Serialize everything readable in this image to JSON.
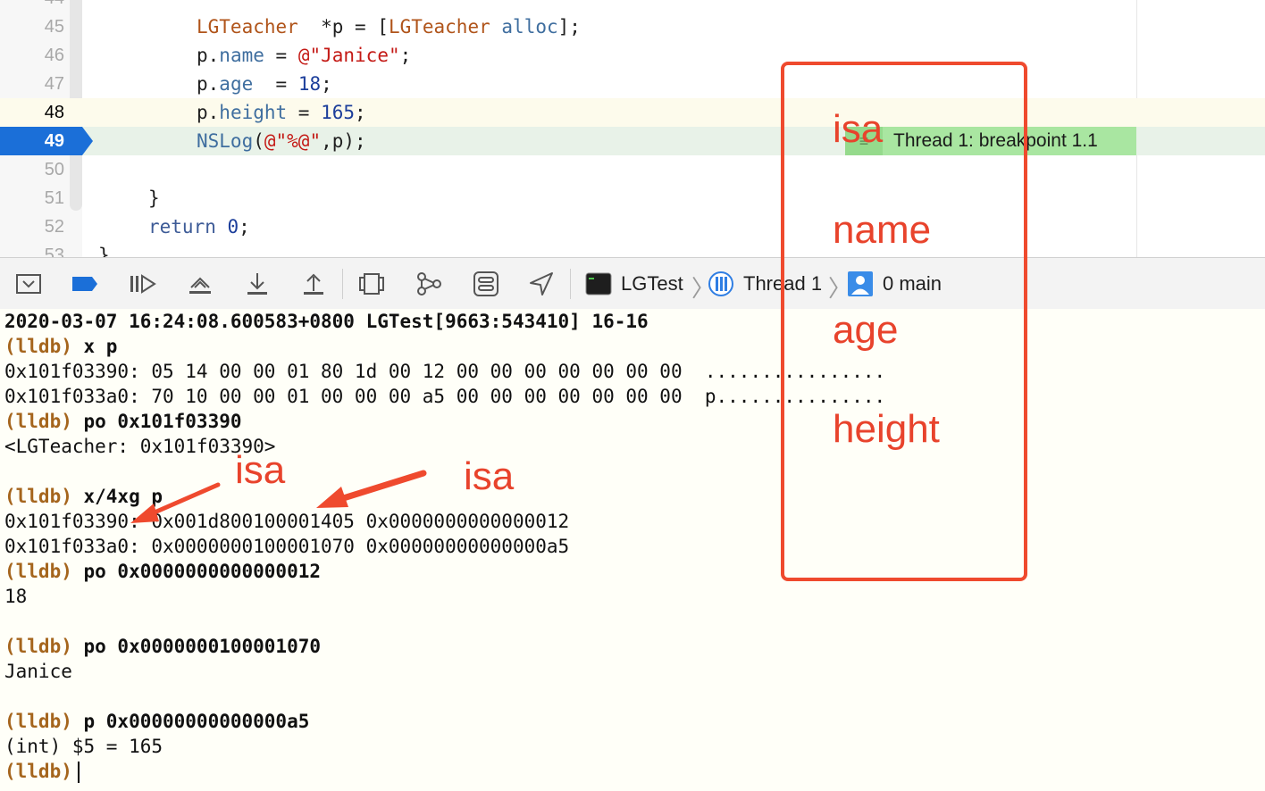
{
  "editor": {
    "lines": [
      {
        "num": "44",
        "state": "normal"
      },
      {
        "num": "45",
        "state": "normal"
      },
      {
        "num": "46",
        "state": "normal"
      },
      {
        "num": "47",
        "state": "normal"
      },
      {
        "num": "48",
        "state": "current"
      },
      {
        "num": "49",
        "state": "exec"
      },
      {
        "num": "50",
        "state": "normal"
      },
      {
        "num": "51",
        "state": "normal"
      },
      {
        "num": "52",
        "state": "normal"
      },
      {
        "num": "53",
        "state": "normal"
      }
    ],
    "code": {
      "l45": {
        "cls": "LGTeacher",
        "mid": "  *p = [",
        "cls2": "LGTeacher",
        "msg": "alloc",
        "end": "];"
      },
      "l46": {
        "obj": "p.",
        "prop": "name",
        "mid": " = ",
        "str": "@\"Janice\"",
        "end": ";"
      },
      "l47": {
        "obj": "p.",
        "prop": "age",
        "mid": "  = ",
        "num": "18",
        "end": ";"
      },
      "l48": {
        "obj": "p.",
        "prop": "height",
        "mid": " = ",
        "num": "165",
        "end": ";"
      },
      "l49": {
        "fn": "NSLog",
        "open": "(",
        "str": "@\"%@\"",
        "end": ",p);"
      },
      "l51": "}",
      "l52": {
        "kw": "return",
        "num": "0",
        "end": ";"
      },
      "l53": "}"
    },
    "breakpoint_label": "Thread 1: breakpoint 1.1",
    "breakpoint_mark": "≡"
  },
  "debugbar": {
    "process": "LGTest",
    "thread": "Thread 1",
    "frame": "0 main"
  },
  "console": {
    "lines": [
      {
        "kind": "bold",
        "text": "2020-03-07 16:24:08.600583+0800 LGTest[9663:543410] 16-16"
      },
      {
        "kind": "cmd",
        "prompt": "(lldb)",
        "text": " x p"
      },
      {
        "kind": "out",
        "text": "0x101f03390: 05 14 00 00 01 80 1d 00 12 00 00 00 00 00 00 00  ................"
      },
      {
        "kind": "out",
        "text": "0x101f033a0: 70 10 00 00 01 00 00 00 a5 00 00 00 00 00 00 00  p..............."
      },
      {
        "kind": "cmd",
        "prompt": "(lldb)",
        "text": " po 0x101f03390"
      },
      {
        "kind": "out",
        "text": "<LGTeacher: 0x101f03390>"
      },
      {
        "kind": "blank",
        "text": ""
      },
      {
        "kind": "cmd",
        "prompt": "(lldb)",
        "text": " x/4xg p"
      },
      {
        "kind": "out",
        "text": "0x101f03390: 0x001d800100001405 0x0000000000000012"
      },
      {
        "kind": "out",
        "text": "0x101f033a0: 0x0000000100001070 0x00000000000000a5"
      },
      {
        "kind": "cmd",
        "prompt": "(lldb)",
        "text": " po 0x0000000000000012"
      },
      {
        "kind": "out",
        "text": "18"
      },
      {
        "kind": "blank",
        "text": ""
      },
      {
        "kind": "cmd",
        "prompt": "(lldb)",
        "text": " po 0x0000000100001070"
      },
      {
        "kind": "out",
        "text": "Janice"
      },
      {
        "kind": "blank",
        "text": ""
      },
      {
        "kind": "cmd",
        "prompt": "(lldb)",
        "text": " p 0x00000000000000a5"
      },
      {
        "kind": "out",
        "text": "(int) $5 = 165"
      },
      {
        "kind": "prompt",
        "prompt": "(lldb)",
        "text": ""
      }
    ]
  },
  "annotations": {
    "box_labels": [
      "isa",
      "name",
      "age",
      "height"
    ],
    "isa_left": "isa",
    "isa_right": "isa",
    "color": "#e8432c"
  },
  "colors": {
    "exec_line": "#1b6fd8",
    "breakpoint_badge": "#a9e6a1",
    "lldb_prompt": "#a5651d",
    "annotation": "#e8432c"
  }
}
